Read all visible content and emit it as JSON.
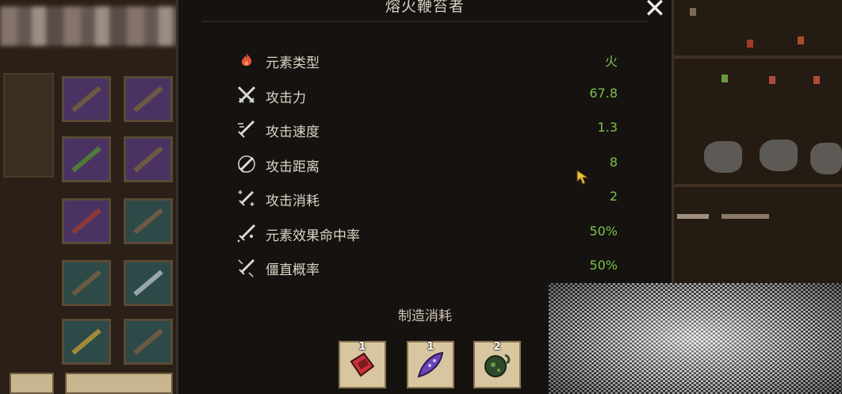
{
  "dialog": {
    "title": "熔火鞭笞者",
    "close_symbol": "✕"
  },
  "stats": [
    {
      "label": "元素类型",
      "value": "火",
      "icon": "fire-icon"
    },
    {
      "label": "攻击力",
      "value": "67.8",
      "icon": "crossed-swords-icon"
    },
    {
      "label": "攻击速度",
      "value": "1.3",
      "icon": "sword-speed-icon"
    },
    {
      "label": "攻击距离",
      "value": "8",
      "icon": "sword-range-icon"
    },
    {
      "label": "攻击消耗",
      "value": "2",
      "icon": "sword-cost-icon"
    },
    {
      "label": "元素效果命中率",
      "value": "50%",
      "icon": "sword-element-icon"
    },
    {
      "label": "僵直概率",
      "value": "50%",
      "icon": "sword-stun-icon"
    }
  ],
  "crafting": {
    "title": "制造消耗",
    "materials": [
      {
        "count": "1",
        "icon": "red-crystal-icon"
      },
      {
        "count": "1",
        "icon": "purple-feather-icon"
      },
      {
        "count": "2",
        "icon": "green-orb-icon"
      }
    ]
  },
  "colors": {
    "value_green": "#7cc24a",
    "label_text": "#dcd4c7",
    "fire_orange": "#e2553a"
  }
}
